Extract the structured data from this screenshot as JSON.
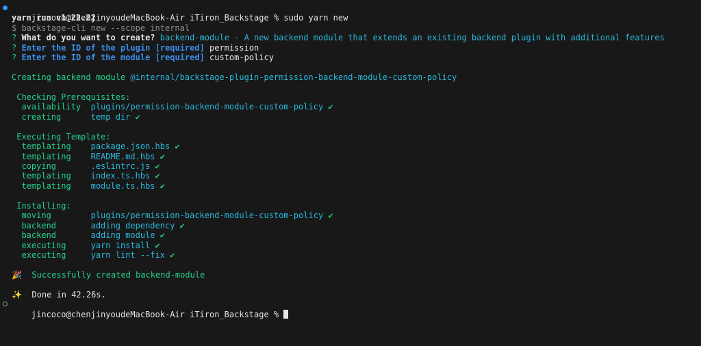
{
  "colors": {
    "background": "#181818",
    "prompt_marker_active": "#3794ff",
    "green": "#23d18b",
    "cyan": "#29b8db",
    "blue": "#3b8eea"
  },
  "prompt": {
    "user_host": "jincoco@chenjinyoudeMacBook-Air",
    "cwd": "iTiron_Backstage",
    "symbol": "%",
    "command": "sudo yarn new"
  },
  "yarn_version": "yarn run v1.22.22",
  "cli_command": "$ backstage-cli new --scope internal",
  "questions": [
    {
      "mark": "?",
      "label": "What do you want to create?",
      "answer": "backend-module - A new backend module that extends an existing backend plugin with additional features"
    },
    {
      "mark": "?",
      "label": "Enter the ID of the plugin",
      "required": "[required]",
      "answer": "permission"
    },
    {
      "mark": "?",
      "label": "Enter the ID of the module",
      "required": "[required]",
      "answer": "custom-policy"
    }
  ],
  "creating_line": {
    "text": "Creating backend module",
    "package": "@internal/backstage-plugin-permission-backend-module-custom-policy"
  },
  "sections": [
    {
      "title": "Checking Prerequisites:",
      "rows": [
        {
          "action": "availability",
          "target": "plugins/permission-backend-module-custom-policy",
          "check": "✔"
        },
        {
          "action": "creating",
          "target": "temp dir",
          "check": "✔"
        }
      ]
    },
    {
      "title": "Executing Template:",
      "rows": [
        {
          "action": "templating",
          "target": "package.json.hbs",
          "check": "✔"
        },
        {
          "action": "templating",
          "target": "README.md.hbs",
          "check": "✔"
        },
        {
          "action": "copying",
          "target": ".eslintrc.js",
          "check": "✔"
        },
        {
          "action": "templating",
          "target": "index.ts.hbs",
          "check": "✔"
        },
        {
          "action": "templating",
          "target": "module.ts.hbs",
          "check": "✔"
        }
      ]
    },
    {
      "title": "Installing:",
      "rows": [
        {
          "action": "moving",
          "target": "plugins/permission-backend-module-custom-policy",
          "check": "✔"
        },
        {
          "action": "backend",
          "target": "adding dependency",
          "check": "✔"
        },
        {
          "action": "backend",
          "target": "adding module",
          "check": "✔"
        },
        {
          "action": "executing",
          "target": "yarn install",
          "check": "✔"
        },
        {
          "action": "executing",
          "target": "yarn lint --fix",
          "check": "✔"
        }
      ]
    }
  ],
  "success": {
    "icon": "🎉",
    "text": "Successfully created backend-module"
  },
  "done": {
    "icon": "✨",
    "text": "Done in 42.26s."
  },
  "final_prompt": {
    "user_host": "jincoco@chenjinyoudeMacBook-Air",
    "cwd": "iTiron_Backstage",
    "symbol": "%"
  }
}
